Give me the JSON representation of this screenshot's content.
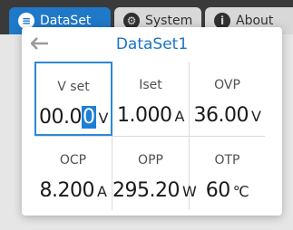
{
  "tabs": [
    {
      "label": "DataSet",
      "icon": "dataset-icon"
    },
    {
      "label": "System",
      "icon": "gear-icon"
    },
    {
      "label": "About",
      "icon": "info-icon"
    }
  ],
  "dialog": {
    "title": "DataSet1",
    "back_icon": "back-arrow-icon"
  },
  "cells": {
    "vset": {
      "label": "V set",
      "value_prefix": "00.0",
      "value_cursor": "0",
      "unit": "V"
    },
    "iset": {
      "label": "Iset",
      "value": "1.000",
      "unit": "A"
    },
    "ovp": {
      "label": "OVP",
      "value": "36.00",
      "unit": "V"
    },
    "ocp": {
      "label": "OCP",
      "value": "8.200",
      "unit": "A"
    },
    "opp": {
      "label": "OPP",
      "value": "295.20",
      "unit": "W"
    },
    "otp": {
      "label": "OTP",
      "value": "60",
      "unit": "℃"
    }
  },
  "colors": {
    "accent": "#1f78c8",
    "title": "#1b73c4",
    "selection": "#2b88d8"
  }
}
